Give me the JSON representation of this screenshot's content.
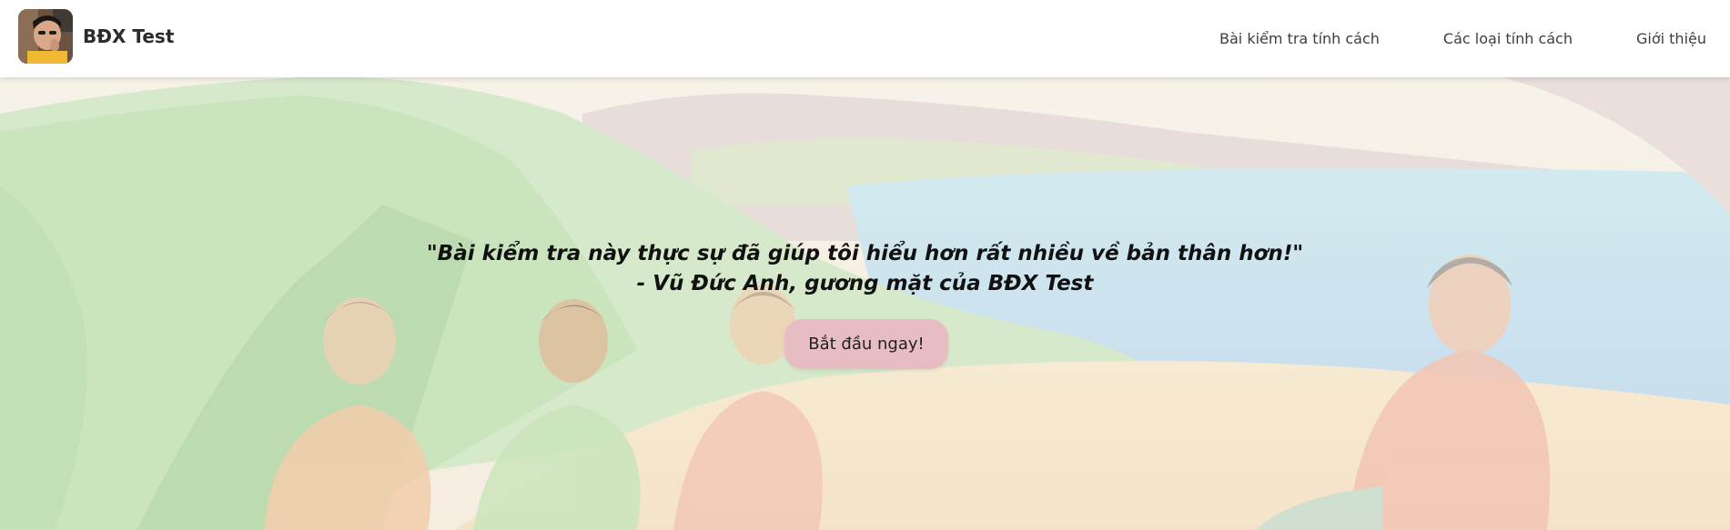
{
  "header": {
    "brand_name": "BĐX Test",
    "nav": [
      {
        "label": "Bài kiểm tra tính cách"
      },
      {
        "label": "Các loại tính cách"
      },
      {
        "label": "Giới thiệu"
      }
    ]
  },
  "hero": {
    "quote_line_1": "\"Bài kiểm tra này thực sự đã giúp tôi hiểu hơn rất nhiều về bản thân hơn!\"",
    "quote_line_2": "- Vũ Đức Anh, gương mặt của BĐX Test",
    "cta_label": "Bắt đầu ngay!"
  },
  "colors": {
    "cta_background": "#e8bcc3",
    "header_background": "#ffffff",
    "text": "#111111"
  }
}
